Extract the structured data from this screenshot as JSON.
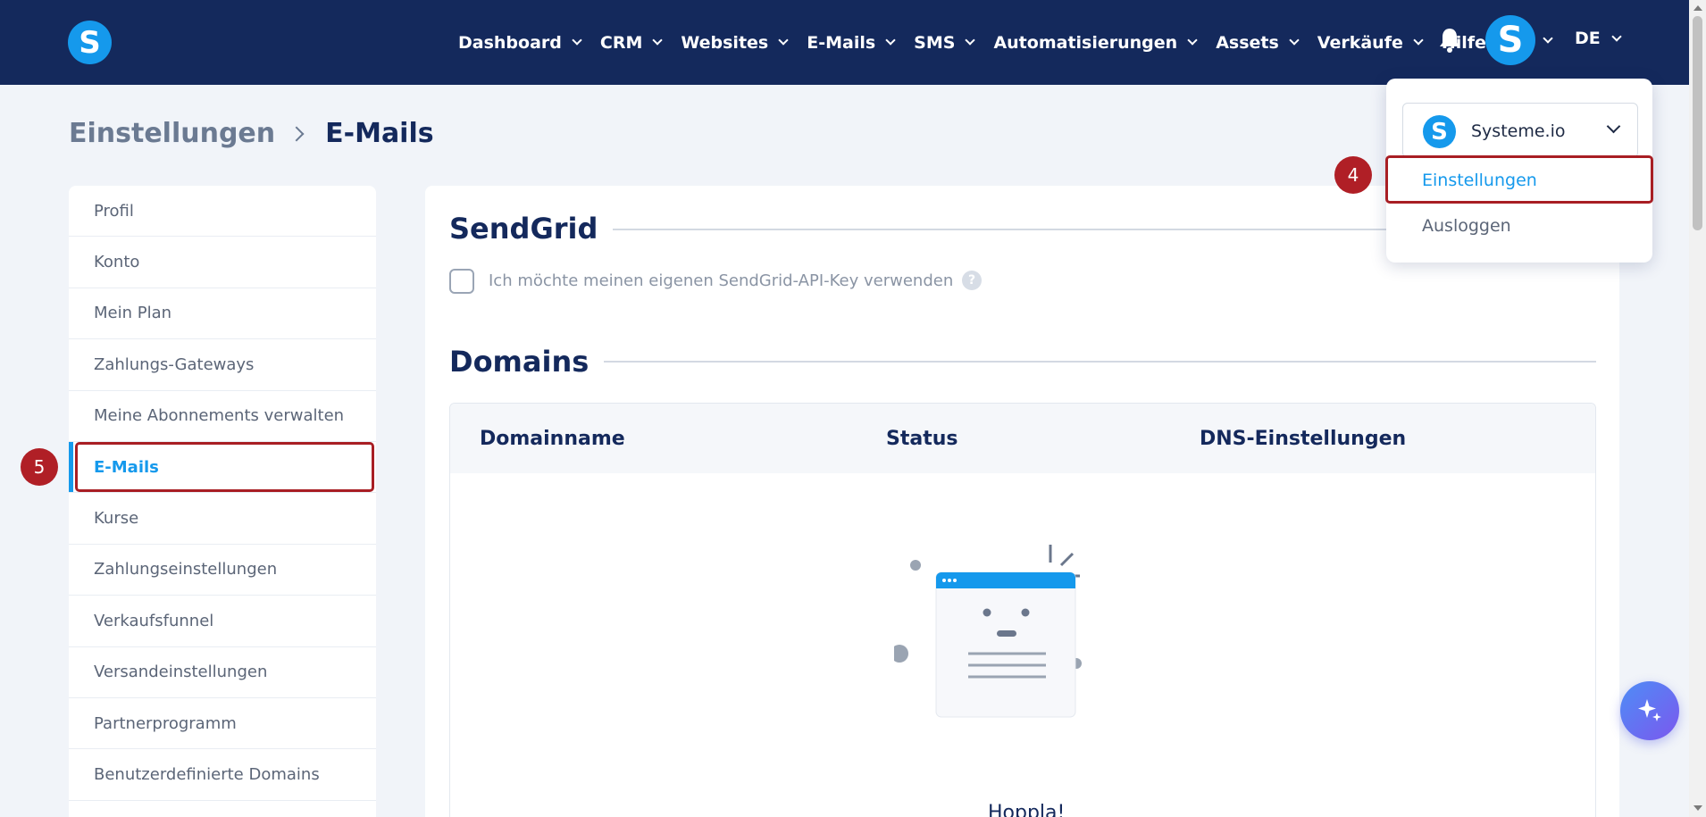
{
  "header": {
    "logo_letter": "S",
    "nav_items": [
      "Dashboard",
      "CRM",
      "Websites",
      "E-Mails",
      "SMS",
      "Automatisierungen",
      "Assets",
      "Verkäufe"
    ],
    "help_label": "Hilfe",
    "avatar_letter": "S",
    "language": "DE"
  },
  "breadcrumb": {
    "parent": "Einstellungen",
    "current": "E-Mails"
  },
  "sidebar": {
    "items": [
      "Profil",
      "Konto",
      "Mein Plan",
      "Zahlungs-Gateways",
      "Meine Abonnements verwalten",
      "E-Mails",
      "Kurse",
      "Zahlungseinstellungen",
      "Verkaufsfunnel",
      "Versandeinstellungen",
      "Partnerprogramm",
      "Benutzerdefinierte Domains"
    ],
    "active_index": 5
  },
  "main": {
    "sendgrid_title": "SendGrid",
    "sendgrid_checkbox_label": "Ich möchte meinen eigenen SendGrid-API-Key verwenden",
    "help_symbol": "?",
    "domains_title": "Domains",
    "table_headers": [
      "Domainname",
      "Status",
      "DNS-Einstellungen"
    ],
    "empty_text": "Hoppla!"
  },
  "dropdown": {
    "account_logo_letter": "S",
    "account_name": "Systeme.io",
    "settings_label": "Einstellungen",
    "logout_label": "Ausloggen"
  },
  "annotations": {
    "step4": "4",
    "step5": "5"
  },
  "colors": {
    "nav_bg": "#14295c",
    "brand_blue": "#1599ec",
    "annotation_red": "#b01f26",
    "page_bg": "#f1f4f9"
  }
}
